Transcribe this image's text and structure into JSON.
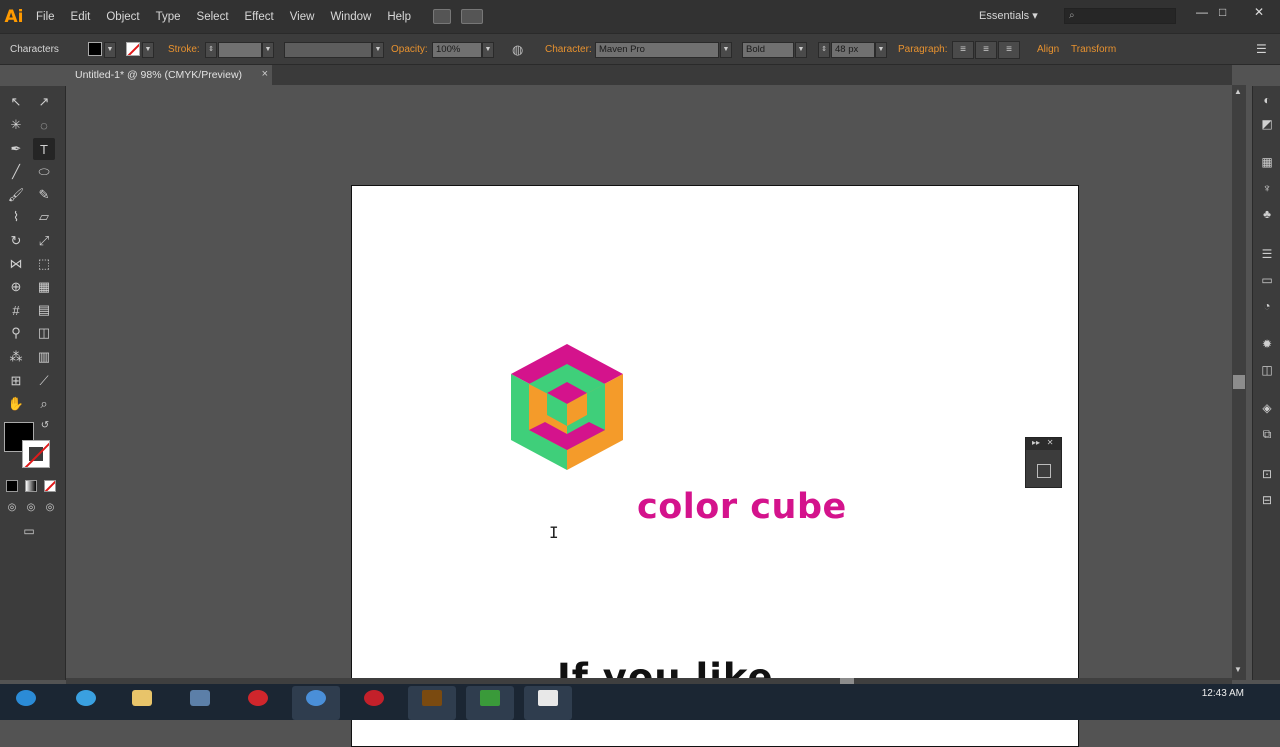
{
  "app": {
    "logo": "Ai"
  },
  "menu": [
    "File",
    "Edit",
    "Object",
    "Type",
    "Select",
    "Effect",
    "View",
    "Window",
    "Help"
  ],
  "workspace": {
    "label": "Essentials"
  },
  "window_controls": {
    "minimize": "—",
    "maximize": "□",
    "close": "✕"
  },
  "controlbar": {
    "panel_name": "Characters",
    "stroke_label": "Stroke:",
    "opacity_label": "Opacity:",
    "opacity_value": "100%",
    "character_label": "Character:",
    "font_family": "Maven Pro",
    "font_style": "Bold",
    "font_size": "48 px",
    "paragraph_label": "Paragraph:",
    "align_label": "Align",
    "transform_label": "Transform"
  },
  "document": {
    "tab_title": "Untitled-1* @ 98% (CMYK/Preview)",
    "close": "×"
  },
  "artwork": {
    "logo_text": "color cube",
    "body_text": "If you like",
    "colors": {
      "magenta": "#d4138c",
      "green": "#3fcf7a",
      "orange": "#f49b2a"
    }
  },
  "taskbar": {
    "clock": "12:43 AM"
  },
  "icons": {
    "tools": [
      "selection-icon",
      "direct-selection-icon",
      "magic-wand-icon",
      "lasso-icon",
      "pen-icon",
      "type-icon",
      "line-icon",
      "ellipse-icon",
      "paintbrush-icon",
      "pencil-icon",
      "blob-brush-icon",
      "eraser-icon",
      "rotate-icon",
      "scale-icon",
      "width-icon",
      "free-transform-icon",
      "shape-builder-icon",
      "perspective-grid-icon",
      "mesh-icon",
      "gradient-icon",
      "eyedropper-icon",
      "blend-icon",
      "symbol-sprayer-icon",
      "column-graph-icon",
      "artboard-icon",
      "slice-icon",
      "hand-icon",
      "zoom-icon"
    ]
  }
}
